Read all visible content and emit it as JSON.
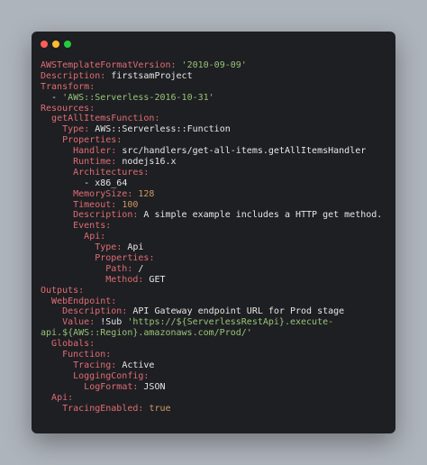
{
  "window": {
    "traffic_lights": [
      "close",
      "minimize",
      "maximize"
    ],
    "colors": {
      "close": "#ff5f56",
      "minimize": "#ffbd2e",
      "maximize": "#27c93f",
      "key": "#e06c75",
      "string": "#98c379",
      "number": "#d19a66"
    }
  },
  "code": {
    "lines": [
      {
        "indent": "",
        "key": "AWSTemplateFormatVersion",
        "sep": ": ",
        "value": "'2010-09-09'",
        "vtype": "s"
      },
      {
        "indent": "",
        "key": "Description",
        "sep": ": ",
        "value": "firstsamProject",
        "vtype": "v"
      },
      {
        "indent": "",
        "key": "Transform",
        "sep": ":",
        "value": "",
        "vtype": "v"
      },
      {
        "indent": "  ",
        "key": "",
        "sep": "- ",
        "value": "'AWS::Serverless-2016-10-31'",
        "vtype": "s"
      },
      {
        "indent": "",
        "key": "Resources",
        "sep": ":",
        "value": "",
        "vtype": "v"
      },
      {
        "indent": "  ",
        "key": "getAllItemsFunction",
        "sep": ":",
        "value": "",
        "vtype": "v"
      },
      {
        "indent": "    ",
        "key": "Type",
        "sep": ": ",
        "value": "AWS::Serverless::Function",
        "vtype": "v"
      },
      {
        "indent": "    ",
        "key": "Properties",
        "sep": ":",
        "value": "",
        "vtype": "v"
      },
      {
        "indent": "      ",
        "key": "Handler",
        "sep": ": ",
        "value": "src/handlers/get-all-items.getAllItemsHandler",
        "vtype": "v"
      },
      {
        "indent": "      ",
        "key": "Runtime",
        "sep": ": ",
        "value": "nodejs16.x",
        "vtype": "v"
      },
      {
        "indent": "      ",
        "key": "Architectures",
        "sep": ":",
        "value": "",
        "vtype": "v"
      },
      {
        "indent": "        ",
        "key": "",
        "sep": "- ",
        "value": "x86_64",
        "vtype": "v"
      },
      {
        "indent": "      ",
        "key": "MemorySize",
        "sep": ": ",
        "value": "128",
        "vtype": "n"
      },
      {
        "indent": "      ",
        "key": "Timeout",
        "sep": ": ",
        "value": "100",
        "vtype": "n"
      },
      {
        "indent": "      ",
        "key": "Description",
        "sep": ": ",
        "value": "A simple example includes a HTTP get method.",
        "vtype": "v"
      },
      {
        "indent": "      ",
        "key": "Events",
        "sep": ":",
        "value": "",
        "vtype": "v"
      },
      {
        "indent": "        ",
        "key": "Api",
        "sep": ":",
        "value": "",
        "vtype": "v"
      },
      {
        "indent": "          ",
        "key": "Type",
        "sep": ": ",
        "value": "Api",
        "vtype": "v"
      },
      {
        "indent": "          ",
        "key": "Properties",
        "sep": ":",
        "value": "",
        "vtype": "v"
      },
      {
        "indent": "            ",
        "key": "Path",
        "sep": ": ",
        "value": "/",
        "vtype": "v"
      },
      {
        "indent": "            ",
        "key": "Method",
        "sep": ": ",
        "value": "GET",
        "vtype": "v"
      },
      {
        "indent": "",
        "key": "Outputs",
        "sep": ":",
        "value": "",
        "vtype": "v"
      },
      {
        "indent": "  ",
        "key": "WebEndpoint",
        "sep": ":",
        "value": "",
        "vtype": "v"
      },
      {
        "indent": "    ",
        "key": "Description",
        "sep": ": ",
        "value": "API Gateway endpoint URL for Prod stage",
        "vtype": "v"
      },
      {
        "indent": "    ",
        "key": "Value",
        "sep": ": ",
        "value": "!Sub 'https://${ServerlessRestApi}.execute-",
        "vtype": "mix",
        "plain": "!Sub ",
        "str": "'https://${ServerlessRestApi}.execute-"
      },
      {
        "indent": "",
        "key": "",
        "sep": "",
        "value": "api.${AWS::Region}.amazonaws.com/Prod/'",
        "vtype": "s"
      },
      {
        "indent": "  ",
        "key": "Globals",
        "sep": ":",
        "value": "",
        "vtype": "v"
      },
      {
        "indent": "    ",
        "key": "Function",
        "sep": ":",
        "value": "",
        "vtype": "v"
      },
      {
        "indent": "      ",
        "key": "Tracing",
        "sep": ": ",
        "value": "Active",
        "vtype": "v"
      },
      {
        "indent": "      ",
        "key": "LoggingConfig",
        "sep": ":",
        "value": "",
        "vtype": "v"
      },
      {
        "indent": "        ",
        "key": "LogFormat",
        "sep": ": ",
        "value": "JSON",
        "vtype": "v"
      },
      {
        "indent": "  ",
        "key": "Api",
        "sep": ":",
        "value": "",
        "vtype": "v"
      },
      {
        "indent": "    ",
        "key": "TracingEnabled",
        "sep": ": ",
        "value": "true",
        "vtype": "n"
      }
    ]
  }
}
